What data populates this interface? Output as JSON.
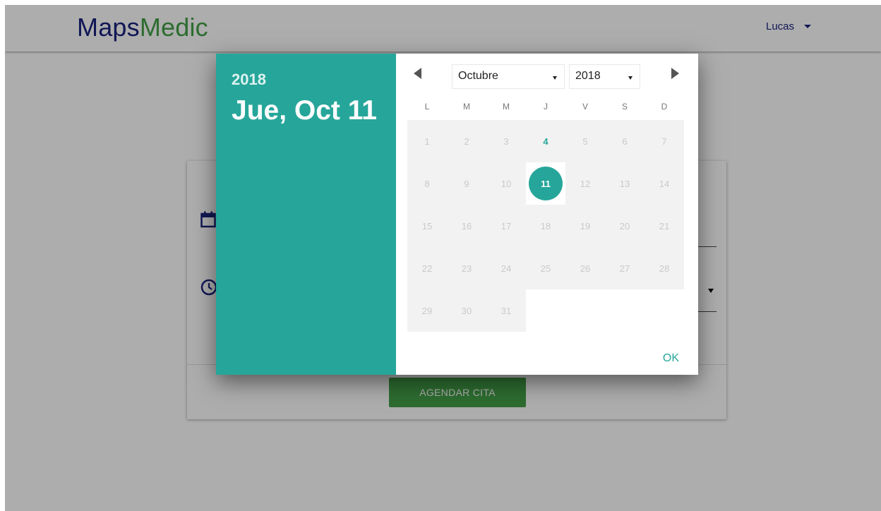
{
  "navbar": {
    "brand_part1": "Maps",
    "brand_part2": "Medic",
    "user_name": "Lucas"
  },
  "form": {
    "submit_label": "AGENDAR CITA"
  },
  "datepicker": {
    "header_year": "2018",
    "header_date": "Jue, Oct 11",
    "month_select": "Octubre",
    "year_select": "2018",
    "weekdays": [
      "L",
      "M",
      "M",
      "J",
      "V",
      "S",
      "D"
    ],
    "weeks": [
      [
        "1",
        "2",
        "3",
        "4",
        "5",
        "6",
        "7"
      ],
      [
        "8",
        "9",
        "10",
        "11",
        "12",
        "13",
        "14"
      ],
      [
        "15",
        "16",
        "17",
        "18",
        "19",
        "20",
        "21"
      ],
      [
        "22",
        "23",
        "24",
        "25",
        "26",
        "27",
        "28"
      ],
      [
        "29",
        "30",
        "31",
        "",
        "",
        "",
        ""
      ]
    ],
    "today_day": "4",
    "selected_day": "11",
    "ok_label": "OK"
  },
  "colors": {
    "primary_teal": "#26a69a",
    "brand_navy": "#1a237e",
    "brand_green": "#43a047"
  }
}
